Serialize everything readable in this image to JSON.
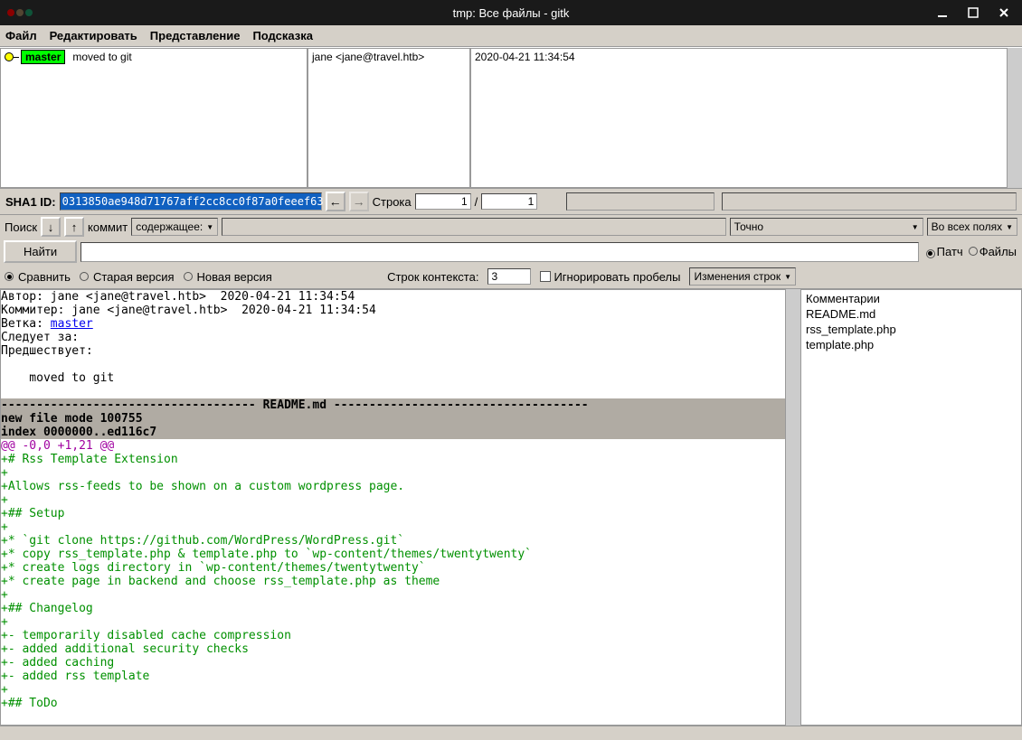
{
  "titlebar": {
    "title": "tmp: Все файлы - gitk"
  },
  "menu": {
    "file": "Файл",
    "edit": "Редактировать",
    "view": "Представление",
    "help": "Подсказка"
  },
  "commits": {
    "branch": "master",
    "subject": "moved to git",
    "author": "jane <jane@travel.htb>",
    "date": "2020-04-21 11:34:54"
  },
  "sha": {
    "label": "SHA1 ID:",
    "value": "0313850ae948d71767aff2cc8cc0f87a0feeef63",
    "line_label": "Строка",
    "line_cur": "1",
    "line_total": "1"
  },
  "search": {
    "label": "Поиск",
    "commit": "коммит",
    "contains": "содержащее:",
    "exact": "Точно",
    "all_fields": "Во всех полях"
  },
  "find": {
    "btn": "Найти"
  },
  "rpanel": {
    "patch": "Патч",
    "files": "Файлы",
    "items": [
      "Комментарии",
      "README.md",
      "rss_template.php",
      "template.php"
    ]
  },
  "diff_cfg": {
    "compare": "Сравнить",
    "old": "Старая версия",
    "new": "Новая версия",
    "ctx_label": "Строк контекста:",
    "ctx_value": "3",
    "ignore_ws": "Игнорировать пробелы",
    "line_diff": "Изменения строк"
  },
  "diff": {
    "author": "Автор: jane <jane@travel.htb>  2020-04-21 11:34:54",
    "committer": "Коммитер: jane <jane@travel.htb>  2020-04-21 11:34:54",
    "branch_lbl": "Ветка: ",
    "branch": "master",
    "follows": "Следует за:",
    "precedes": "Предшествует:",
    "msg": "    moved to git",
    "file_sep": "------------------------------------ README.md ------------------------------------",
    "mode": "new file mode 100755",
    "index": "index 0000000..ed116c7",
    "hunk": "@@ -0,0 +1,21 @@",
    "lines": [
      "+# Rss Template Extension",
      "+",
      "+Allows rss-feeds to be shown on a custom wordpress page.",
      "+",
      "+## Setup",
      "+",
      "+* `git clone https://github.com/WordPress/WordPress.git`",
      "+* copy rss_template.php & template.php to `wp-content/themes/twentytwenty`",
      "+* create logs directory in `wp-content/themes/twentytwenty`",
      "+* create page in backend and choose rss_template.php as theme",
      "+",
      "+## Changelog",
      "+",
      "+- temporarily disabled cache compression",
      "+- added additional security checks",
      "+- added caching",
      "+- added rss template",
      "+",
      "+## ToDo"
    ]
  }
}
